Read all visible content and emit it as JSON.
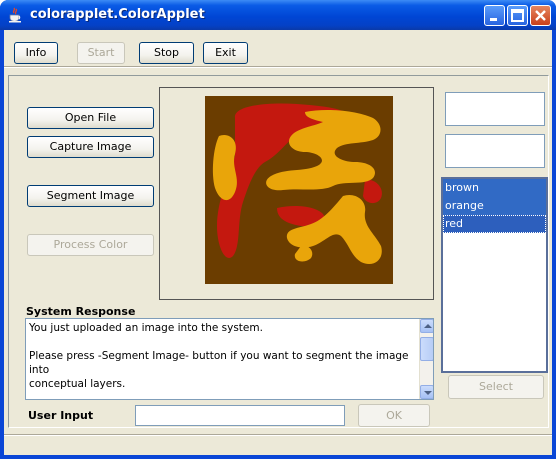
{
  "window": {
    "title": "colorapplet.ColorApplet",
    "app_icon": "java-cup-icon",
    "controls": [
      "minimize-icon",
      "maximize-icon",
      "close-icon"
    ]
  },
  "toolbar": {
    "info_label": "Info",
    "start_label": "Start",
    "stop_label": "Stop",
    "exit_label": "Exit"
  },
  "actions": {
    "open_file_label": "Open File",
    "capture_image_label": "Capture Image",
    "segment_image_label": "Segment Image",
    "process_color_label": "Process Color"
  },
  "image": {
    "colors": {
      "background": "#6b3d00",
      "orange": "#e9a50a",
      "red": "#c4180f"
    }
  },
  "system_response": {
    "heading": "System Response",
    "lines": [
      "You just uploaded an image into the system.",
      "",
      "Please press -Segment Image- button if you want to segment the image into",
      "conceptual layers."
    ]
  },
  "user_input": {
    "label": "User Input",
    "value": "",
    "ok_label": "OK"
  },
  "color_list": {
    "items": [
      "brown",
      "orange",
      "red"
    ],
    "select_label": "Select"
  },
  "theme": {
    "title_blue": "#0046d5",
    "selection_blue": "#316ac5",
    "window_face": "#ece9d8"
  }
}
